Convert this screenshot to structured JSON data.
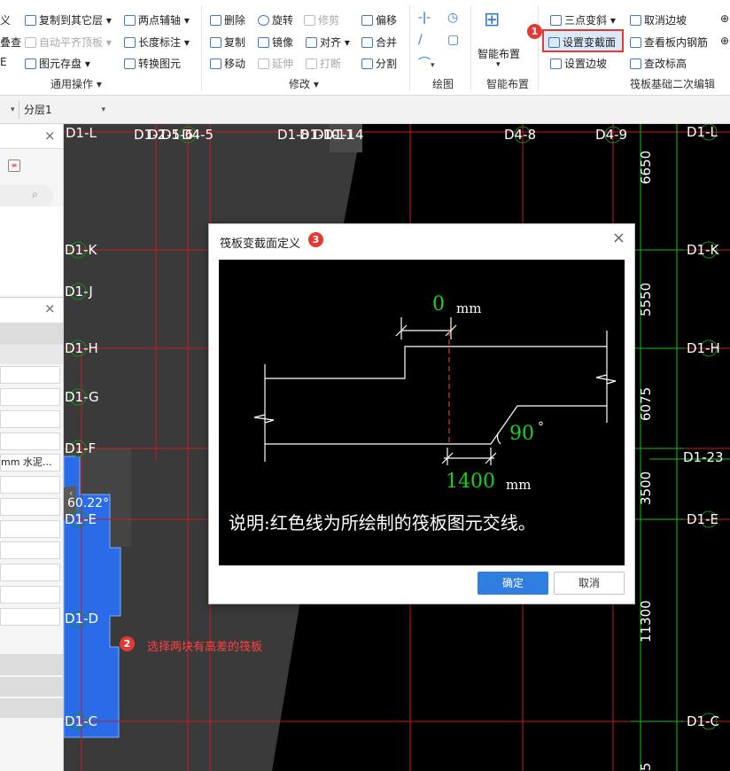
{
  "ribbon": {
    "col0": [
      "义",
      "叠查",
      "E"
    ],
    "common": {
      "copy_to_floor": "复制到其它层",
      "auto_align_top": "自动平齐顶板",
      "save_element": "图元存盘",
      "two_point_axis": "两点辅轴",
      "length_dim": "长度标注",
      "convert_element": "转换图元",
      "group_label": "通用操作"
    },
    "modify": {
      "delete": "删除",
      "rotate": "旋转",
      "trim": "修剪",
      "offset": "偏移",
      "copy": "复制",
      "mirror": "镜像",
      "align": "对齐",
      "merge": "合并",
      "move": "移动",
      "extend": "延伸",
      "break": "打断",
      "split": "分割",
      "group_label": "修改"
    },
    "draw": {
      "group_label": "绘图"
    },
    "smart": {
      "button_label": "智能布置",
      "group_label": "智能布置"
    },
    "raft": {
      "three_point_slope": "三点变斜",
      "set_section_change": "设置变截面",
      "set_edge_slope": "设置边坡",
      "cancel_edge_slope": "取消边坡",
      "view_rebar": "查看板内钢筋",
      "check_elevation": "查改标高",
      "group_label": "筏板基础二次编辑"
    },
    "badge1": "1"
  },
  "subbar": {
    "floor_select": "分层1"
  },
  "left_panel": {
    "rows": [
      "",
      "",
      "",
      "",
      "mm 水泥...",
      "",
      "",
      "",
      "",
      "",
      "",
      ""
    ]
  },
  "canvas": {
    "top_labels": [
      "D1-L",
      "D1-2",
      "D1-5",
      "D1-6",
      "D4-5",
      "D1-8",
      "D1-10",
      "D1-11",
      "D1-14",
      "D4-8",
      "D4-9"
    ],
    "left_labels": [
      "D1-L",
      "D1-K",
      "D1-J",
      "D1-H",
      "D1-G",
      "D1-F",
      "D1-E",
      "D1-D",
      "D1-C"
    ],
    "right_labels": [
      "D1-L",
      "D1-K",
      "D1-H",
      "D1-23",
      "D1-E",
      "D1-C"
    ],
    "dimensions": [
      "6650",
      "5550",
      "6075",
      "3500",
      "11300",
      "5"
    ],
    "angle_text": "60.22°",
    "badge2": "2",
    "instruction": "选择两块有高差的筏板"
  },
  "dialog": {
    "title": "筏板变截面定义",
    "badge3": "3",
    "offset_value": "0",
    "offset_unit": "mm",
    "angle_value": "90",
    "angle_unit": "°",
    "width_value": "1400",
    "width_unit": "mm",
    "explanation": "说明:红色线为所绘制的筏板图元交线。",
    "ok_label": "确定",
    "cancel_label": "取消",
    "close_glyph": "×"
  },
  "colors": {
    "accent_red": "#e53935",
    "cad_green": "#14d414",
    "axis_red": "#c81e1e",
    "slab_blue": "#2a6be8",
    "primary_button": "#2f7ee0"
  }
}
